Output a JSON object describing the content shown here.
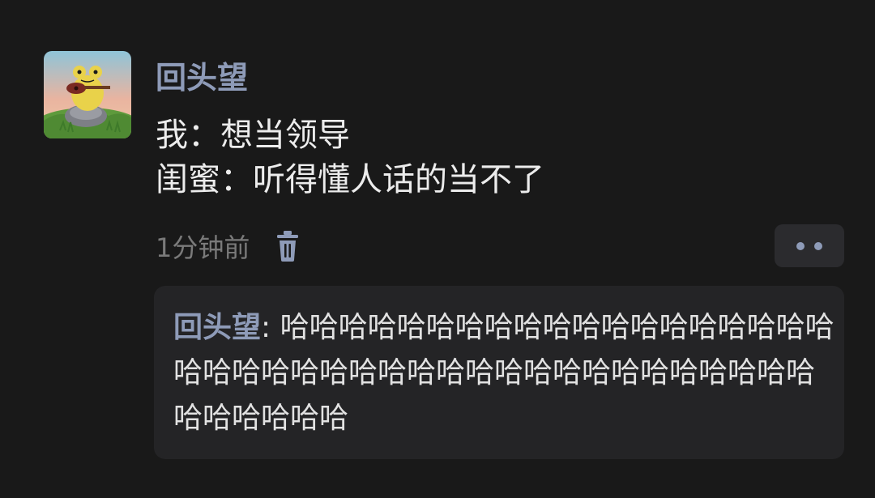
{
  "post": {
    "username": "回头望",
    "content_lines": [
      "我：想当领导",
      "闺蜜：听得懂人话的当不了"
    ],
    "timestamp": "1分钟前",
    "icons": {
      "avatar": "frog-with-guitar-avatar",
      "delete": "trash-icon",
      "more": "more-dots-icon"
    }
  },
  "reply": {
    "author": "回头望",
    "separator": ": ",
    "text": "哈哈哈哈哈哈哈哈哈哈哈哈哈哈哈哈哈哈哈哈哈哈哈哈哈哈哈哈哈哈哈哈哈哈哈哈哈哈哈哈哈哈哈哈哈哈哈"
  },
  "colors": {
    "background": "#191919",
    "accent_name": "#8e9bb8",
    "text": "#ececec",
    "muted": "#7a7a7a",
    "reply_bg": "#242426",
    "button_bg": "#2b2b2e"
  }
}
